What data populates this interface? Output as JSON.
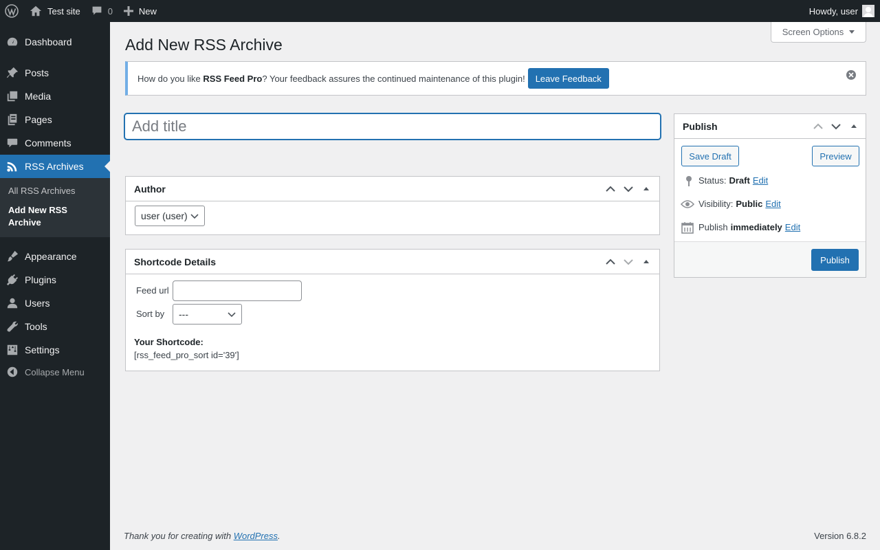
{
  "adminbar": {
    "site_name": "Test site",
    "comments_count": "0",
    "new_label": "New",
    "howdy": "Howdy, user"
  },
  "sidebar": {
    "items": [
      {
        "label": "Dashboard",
        "icon": "dashboard-icon"
      },
      {
        "label": "Posts",
        "icon": "pushpin-icon"
      },
      {
        "label": "Media",
        "icon": "media-icon"
      },
      {
        "label": "Pages",
        "icon": "pages-icon"
      },
      {
        "label": "Comments",
        "icon": "comment-icon"
      },
      {
        "label": "RSS Archives",
        "icon": "rss-icon",
        "current": true
      },
      {
        "label": "Appearance",
        "icon": "brush-icon"
      },
      {
        "label": "Plugins",
        "icon": "plugin-icon"
      },
      {
        "label": "Users",
        "icon": "user-icon"
      },
      {
        "label": "Tools",
        "icon": "wrench-icon"
      },
      {
        "label": "Settings",
        "icon": "settings-icon"
      },
      {
        "label": "Collapse Menu",
        "icon": "collapse-icon"
      }
    ],
    "submenu": [
      "All RSS Archives",
      "Add New RSS Archive"
    ]
  },
  "screen_options": "Screen Options",
  "page_title": "Add New RSS Archive",
  "notice": {
    "text_before": "How do you like ",
    "plugin_name": "RSS Feed Pro",
    "text_after": "? Your feedback assures the continued maintenance of this plugin!",
    "button": "Leave Feedback"
  },
  "title_placeholder": "Add title",
  "author_box": {
    "title": "Author",
    "selected": "user (user)"
  },
  "shortcode_box": {
    "title": "Shortcode Details",
    "feed_url_label": "Feed url",
    "feed_url_value": "",
    "sort_by_label": "Sort by",
    "sort_by_value": "---",
    "your_shortcode_label": "Your Shortcode:",
    "shortcode": "[rss_feed_pro_sort id='39']"
  },
  "publish_box": {
    "title": "Publish",
    "save_draft": "Save Draft",
    "preview": "Preview",
    "status_label": "Status:",
    "status_value": "Draft",
    "visibility_label": "Visibility:",
    "visibility_value": "Public",
    "publish_label": "Publish",
    "publish_value": "immediately",
    "edit": "Edit",
    "publish_button": "Publish"
  },
  "footer": {
    "thanks_before": "Thank you for creating with ",
    "wordpress_link": "WordPress",
    "thanks_after": ".",
    "version": "Version 6.8.2"
  },
  "colors": {
    "admin_dark": "#1d2327",
    "accent": "#2271b1",
    "background": "#f0f0f1"
  }
}
